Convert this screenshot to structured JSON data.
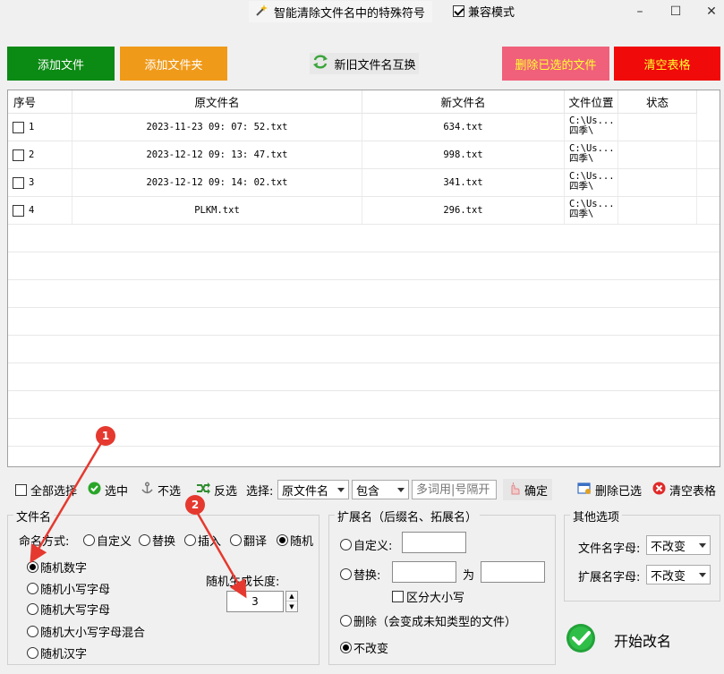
{
  "titlebar": {
    "app_title": "智能清除文件名中的特殊符号",
    "compat_label": "兼容模式",
    "compat_checked": true,
    "minimize": "–",
    "maximize": "☐",
    "close": "✕"
  },
  "top_buttons": {
    "add_file": "添加文件",
    "add_folder": "添加文件夹",
    "swap_names": "新旧文件名互换",
    "delete_selected": "删除已选的文件",
    "clear_table": "清空表格"
  },
  "table": {
    "columns": [
      "序号",
      "原文件名",
      "新文件名",
      "文件位置",
      "状态"
    ],
    "rows": [
      {
        "index": "1",
        "original": "2023-11-23 09: 07: 52.txt",
        "new": "634.txt",
        "location_1": "C:\\Us...",
        "location_2": "四季\\",
        "status": ""
      },
      {
        "index": "2",
        "original": "2023-12-12 09: 13: 47.txt",
        "new": "998.txt",
        "location_1": "C:\\Us...",
        "location_2": "四季\\",
        "status": ""
      },
      {
        "index": "3",
        "original": "2023-12-12 09: 14: 02.txt",
        "new": "341.txt",
        "location_1": "C:\\Us...",
        "location_2": "四季\\",
        "status": ""
      },
      {
        "index": "4",
        "original": "PLKM.txt",
        "new": "296.txt",
        "location_1": "C:\\Us...",
        "location_2": "四季\\",
        "status": ""
      }
    ]
  },
  "toolbar": {
    "select_all": "全部选择",
    "select": "选中",
    "unselect": "不选",
    "invert": "反选",
    "choose_label": "选择:",
    "field_select": "原文件名",
    "match_select": "包含",
    "keyword_placeholder": "多词用|号隔开",
    "confirm": "确定",
    "delete_selected": "删除已选",
    "clear_table": "清空表格"
  },
  "filename_group": {
    "title": "文件名",
    "mode_label": "命名方式:",
    "modes": [
      "自定义",
      "替换",
      "插入",
      "翻译",
      "随机"
    ],
    "selected_mode": "随机",
    "random_options": [
      "随机数字",
      "随机小写字母",
      "随机大写字母",
      "随机大小写字母混合",
      "随机汉字"
    ],
    "selected_random": "随机数字",
    "length_label": "随机生成长度:",
    "length_value": "3"
  },
  "ext_group": {
    "title": "扩展名（后缀名、拓展名）",
    "custom_label": "自定义:",
    "replace_label": "替换:",
    "to_label": "为",
    "case_label": "区分大小写",
    "delete_label": "删除（会变成未知类型的文件）",
    "nochange_label": "不改变",
    "selected": "不改变"
  },
  "other_group": {
    "title": "其他选项",
    "filename_case_label": "文件名字母:",
    "filename_case_value": "不改变",
    "ext_case_label": "扩展名字母:",
    "ext_case_value": "不改变"
  },
  "start_button": "开始改名",
  "annotations": [
    "1",
    "2"
  ]
}
